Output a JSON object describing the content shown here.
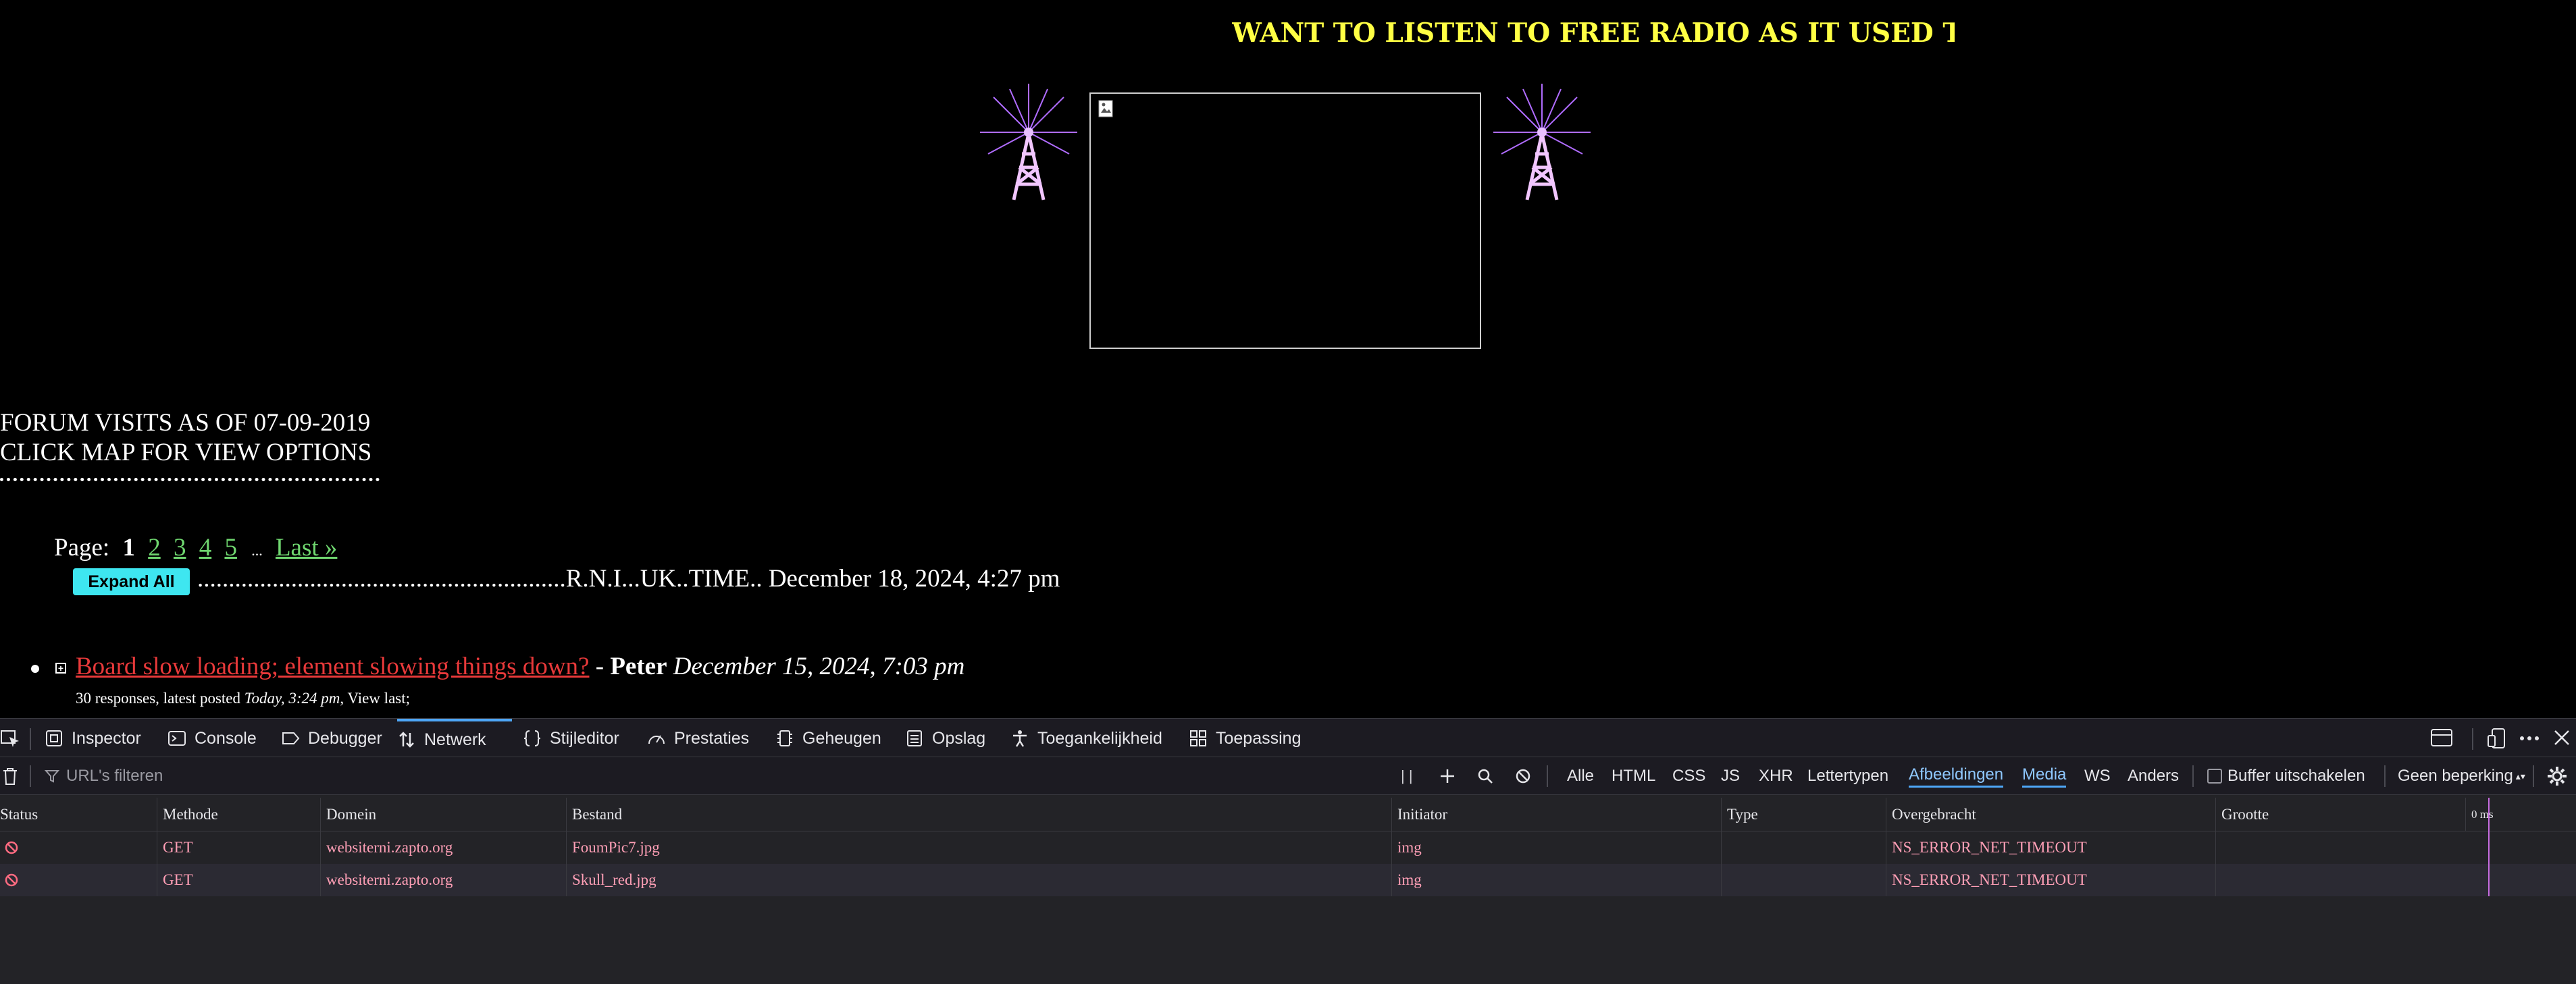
{
  "page": {
    "marquee": "WANT TO LISTEN TO FREE RADIO AS IT USED TO BE J",
    "visits_line1": "FORUM VISITS AS OF 07-09-2019",
    "visits_line2": "CLICK MAP FOR VIEW OPTIONS",
    "pager": {
      "label": "Page:",
      "current": "1",
      "pages": [
        "2",
        "3",
        "4",
        "5"
      ],
      "ellipsis": "...",
      "last": "Last »"
    },
    "expand_all": "Expand All",
    "ticker": "...........................................................R.N.I...UK..TIME.. December 18, 2024, 4:27 pm",
    "topic": {
      "title": "Board slow loading; element slowing things down?",
      "dash": " - ",
      "author": "Peter",
      "date": "December 15, 2024, 7:03 pm",
      "meta_prefix": "30 responses, latest posted ",
      "meta_today": "Today, 3:24 pm",
      "meta_suffix": ", View last;"
    }
  },
  "devtools": {
    "tabs": [
      {
        "label": "Inspector",
        "icon": "inspector-icon"
      },
      {
        "label": "Console",
        "icon": "console-icon"
      },
      {
        "label": "Debugger",
        "icon": "debugger-icon"
      },
      {
        "label": "Netwerk",
        "icon": "network-icon",
        "active": true
      },
      {
        "label": "Stijleditor",
        "icon": "style-editor-icon"
      },
      {
        "label": "Prestaties",
        "icon": "performance-icon"
      },
      {
        "label": "Geheugen",
        "icon": "memory-icon"
      },
      {
        "label": "Opslag",
        "icon": "storage-icon"
      },
      {
        "label": "Toegankelijkheid",
        "icon": "accessibility-icon"
      },
      {
        "label": "Toepassing",
        "icon": "application-icon"
      }
    ],
    "filter_placeholder": "URL's filteren",
    "types": [
      "Alle",
      "HTML",
      "CSS",
      "JS",
      "XHR",
      "Lettertypen",
      "Afbeeldingen",
      "Media",
      "WS",
      "Anders"
    ],
    "active_types": [
      "Afbeeldingen",
      "Media"
    ],
    "disable_cache": "Buffer uitschakelen",
    "throttle": "Geen beperking",
    "columns": [
      "Status",
      "Methode",
      "Domein",
      "Bestand",
      "Initiator",
      "Type",
      "Overgebracht",
      "Grootte",
      "0 ms"
    ],
    "rows": [
      {
        "method": "GET",
        "domain": "websiterni.zapto.org",
        "file": "FoumPic7.jpg",
        "initiator": "img",
        "type": "",
        "transferred": "NS_ERROR_NET_TIMEOUT",
        "size": ""
      },
      {
        "method": "GET",
        "domain": "websiterni.zapto.org",
        "file": "Skull_red.jpg",
        "initiator": "img",
        "type": "",
        "transferred": "NS_ERROR_NET_TIMEOUT",
        "size": ""
      }
    ],
    "colors": {
      "error": "#ff9fb6",
      "accent": "#4ea7f7",
      "panel": "#232327"
    }
  }
}
